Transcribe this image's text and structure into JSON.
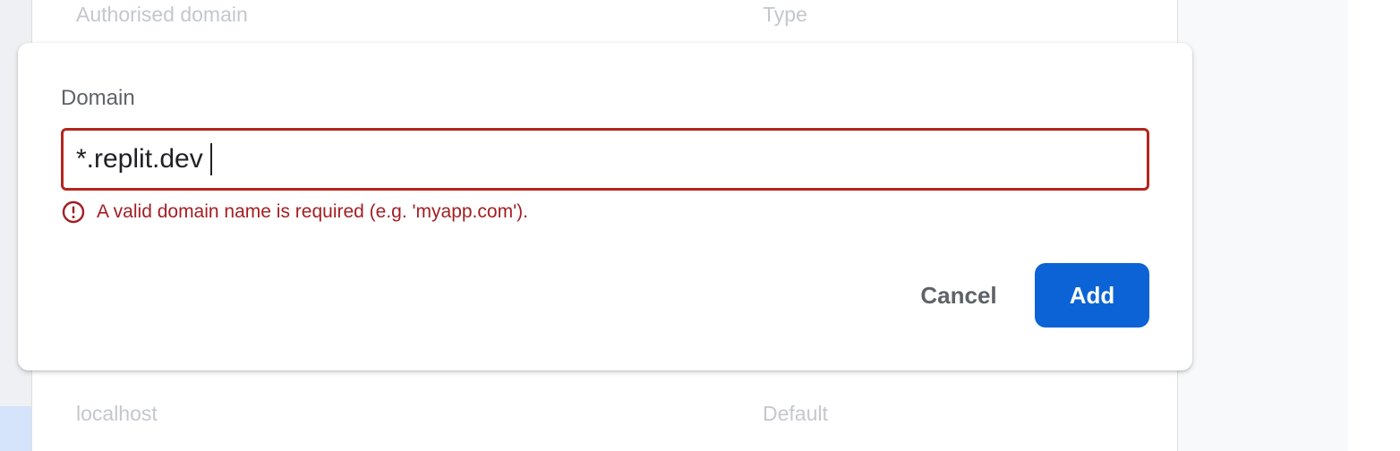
{
  "background_table": {
    "header": {
      "domain_col": "Authorised domain",
      "type_col": "Type"
    },
    "rows": [
      {
        "domain": "localhost",
        "type": "Default"
      }
    ]
  },
  "dialog": {
    "field_label": "Domain",
    "input_value": "*.replit.dev",
    "error_message": "A valid domain name is required (e.g. 'myapp.com').",
    "cancel_label": "Cancel",
    "add_label": "Add"
  },
  "colors": {
    "accent": "#0b63d6",
    "error": "#b3261e",
    "error_text": "#a31e23"
  },
  "icons": {
    "error": "error-circle-icon"
  }
}
